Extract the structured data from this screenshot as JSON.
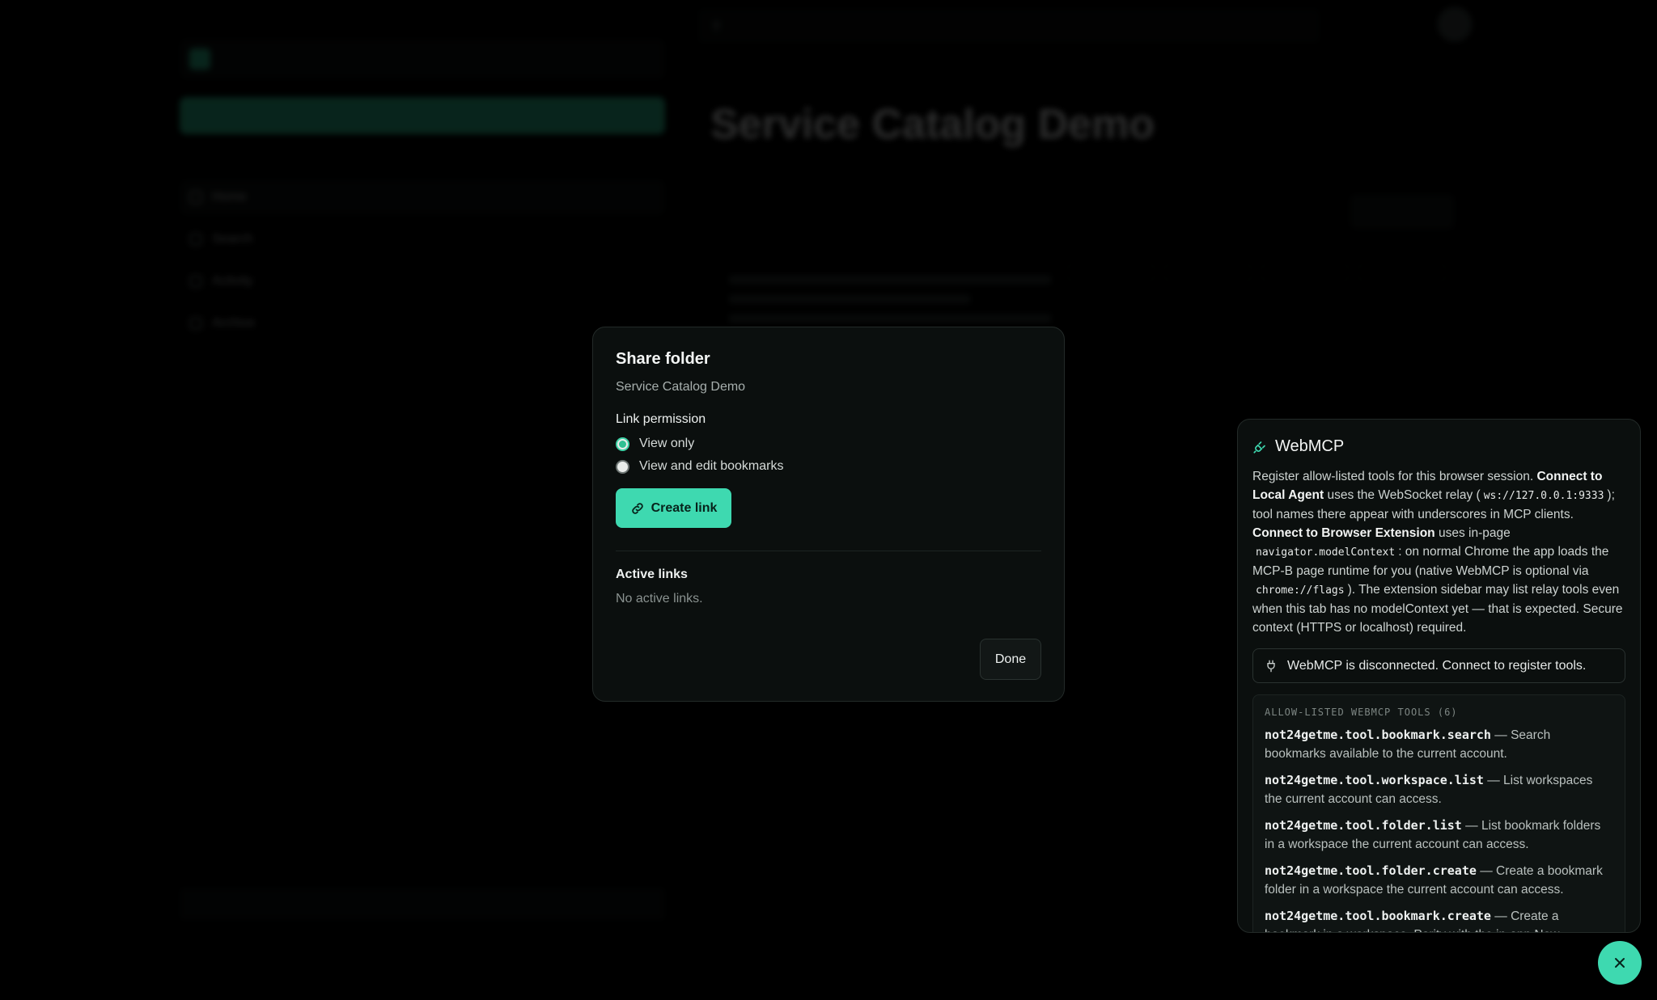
{
  "background": {
    "sidebar_nav": [
      "Home",
      "Search",
      "Activity",
      "Archive"
    ]
  },
  "modal": {
    "title": "Share folder",
    "subtitle": "Service Catalog Demo",
    "permission_label": "Link permission",
    "options": [
      {
        "label": "View only",
        "selected": true
      },
      {
        "label": "View and edit bookmarks",
        "selected": false
      }
    ],
    "create_label": "Create link",
    "active_title": "Active links",
    "active_empty": "No active links.",
    "done_label": "Done"
  },
  "panel": {
    "title": "WebMCP",
    "desc": {
      "p1": "Register allow-listed tools for this browser session.",
      "b1": "Connect to Local Agent",
      "p2": "uses the WebSocket relay (",
      "c1": "ws://127.0.0.1:9333",
      "p3": "); tool names there appear with underscores in MCP clients.",
      "b2": "Connect to Browser Extension",
      "p4": "uses in-page",
      "c2": "navigator.modelContext",
      "p5": ": on normal Chrome the app loads the MCP-B page runtime for you (native WebMCP is optional via",
      "c3": "chrome://flags",
      "p6": "). The extension sidebar may list relay tools even when this tab has no modelContext yet — that is expected. Secure context (HTTPS or localhost) required."
    },
    "status": "WebMCP is disconnected. Connect to register tools.",
    "tools_label": "ALLOW-LISTED WEBMCP TOOLS (6)",
    "tools": [
      {
        "name": "not24getme.tool.bookmark.search",
        "desc": " — Search bookmarks available to the current account."
      },
      {
        "name": "not24getme.tool.workspace.list",
        "desc": " — List workspaces the current account can access."
      },
      {
        "name": "not24getme.tool.folder.list",
        "desc": " — List bookmark folders in a workspace the current account can access."
      },
      {
        "name": "not24getme.tool.folder.create",
        "desc": " — Create a bookmark folder in a workspace the current account can access."
      },
      {
        "name": "not24getme.tool.bookmark.create",
        "desc": " — Create a bookmark in a workspace. Parity with the in-app New"
      }
    ]
  },
  "colors": {
    "accent": "#3ed9b0",
    "surface": "#0b0f0e",
    "border": "#232a28"
  }
}
